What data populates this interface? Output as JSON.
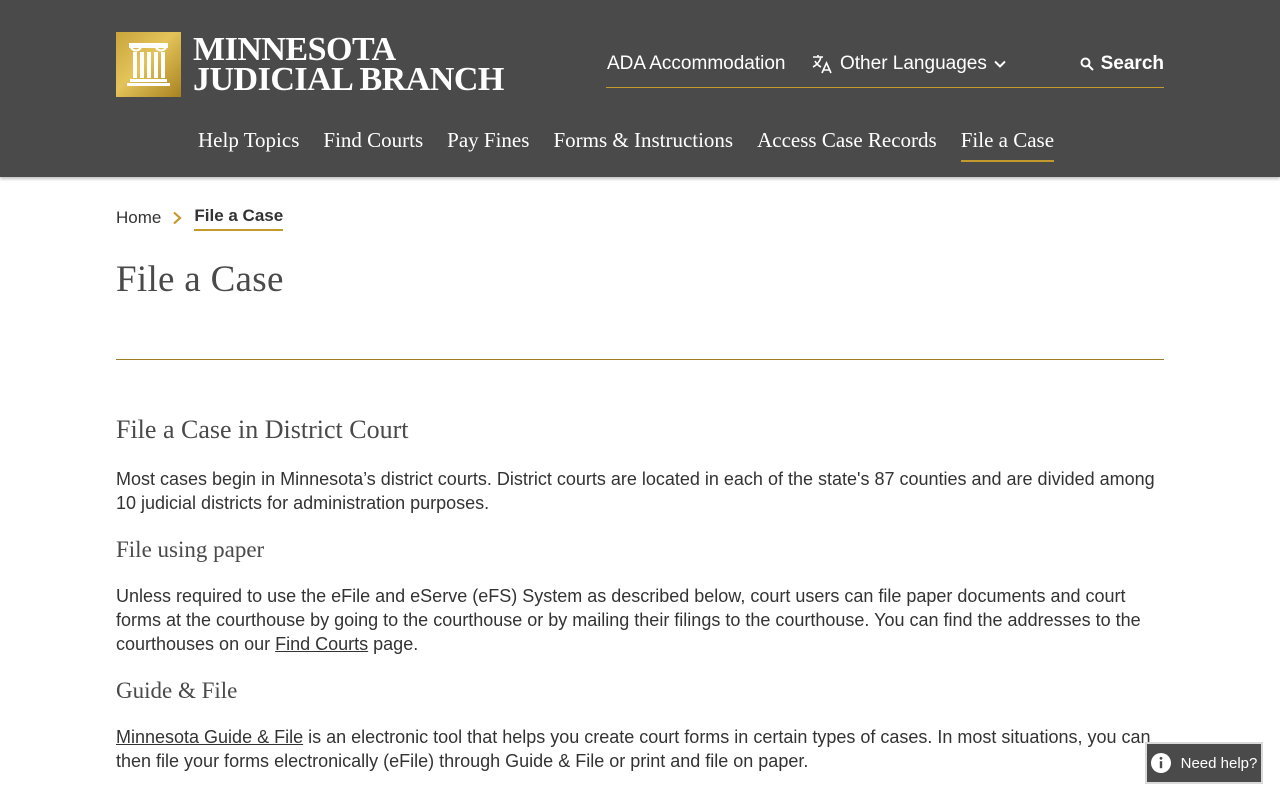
{
  "header": {
    "logo": {
      "line1": "MINNESOTA",
      "line2": "JUDICIAL BRANCH"
    },
    "utility": {
      "ada": "ADA Accommodation",
      "languages": "Other Languages",
      "search": "Search"
    },
    "nav": [
      {
        "label": "Help Topics"
      },
      {
        "label": "Find Courts"
      },
      {
        "label": "Pay Fines"
      },
      {
        "label": "Forms & Instructions"
      },
      {
        "label": "Access Case Records"
      },
      {
        "label": "File a Case",
        "active": true
      }
    ]
  },
  "breadcrumb": {
    "home": "Home",
    "current": "File a Case"
  },
  "page_title": "File a Case",
  "content": {
    "section1": {
      "heading": "File a Case in District Court",
      "body": "Most cases begin in Minnesota’s district courts. District courts are located in each of the state's 87 counties and are divided among 10 judicial districts for administration purposes."
    },
    "section2": {
      "heading": "File using paper",
      "body_before": "Unless required to use the eFile and eServe (eFS) System as described below, court users can file paper documents and court forms at the courthouse by going to the courthouse or by mailing their filings to the courthouse. You can find the addresses to the courthouses on our ",
      "link": "Find Courts",
      "body_after": " page."
    },
    "section3": {
      "heading": "Guide & File",
      "link": "Minnesota Guide & File",
      "body_after": " is an electronic tool that helps you create court forms in certain types of cases. In most situations, you can then file your forms electronically (eFile) through Guide & File or print and file on paper."
    }
  },
  "help_button": {
    "label": "Need help?"
  },
  "colors": {
    "header_bg": "#4a4a4a",
    "accent_gold": "#c49a2c",
    "text": "#333333"
  }
}
